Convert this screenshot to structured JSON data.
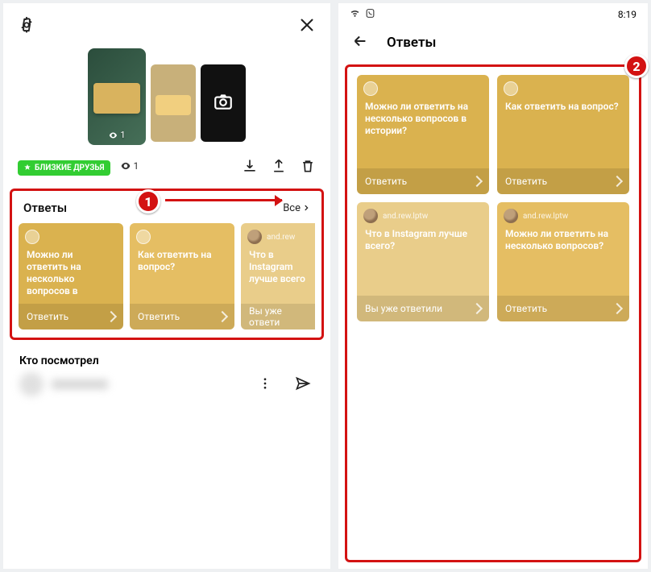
{
  "left": {
    "pill_label": "БЛИЗКИЕ ДРУЗЬЯ",
    "view_count": "1",
    "view_count2": "1",
    "section_title": "Ответы",
    "all_link": "Все",
    "bubble": "1",
    "cards": [
      {
        "username": "",
        "question": "Можно ли ответить на несколько вопросов в",
        "footer": "Ответить"
      },
      {
        "username": "",
        "question": "Как ответить на вопрос?",
        "footer": "Ответить"
      },
      {
        "username": "and.rew",
        "question": "Что в Instagram лучше всего",
        "footer": "Вы уже ответи"
      }
    ],
    "who_saw": "Кто посмотрел"
  },
  "right": {
    "time": "8:19",
    "title": "Ответы",
    "bubble": "2",
    "cards": [
      {
        "username": "",
        "question": "Можно ли ответить на несколько вопросов в истории?",
        "footer": "Ответить",
        "tone": "c1",
        "avatar": "plain"
      },
      {
        "username": "",
        "question": "Как ответить на вопрос?",
        "footer": "Ответить",
        "tone": "c1",
        "avatar": "plain"
      },
      {
        "username": "and.rew.lptw",
        "question": "Что в Instagram лучше всего?",
        "footer": "Вы уже ответили",
        "tone": "c3",
        "avatar": "photo"
      },
      {
        "username": "and.rew.lptw",
        "question": "Можно ли ответить на несколько вопросов?",
        "footer": "Ответить",
        "tone": "c2",
        "avatar": "photo"
      }
    ]
  }
}
